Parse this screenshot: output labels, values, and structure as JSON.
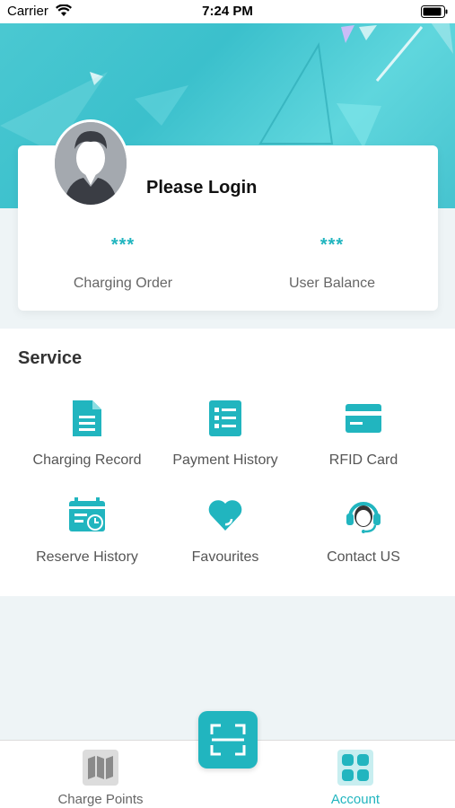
{
  "status_bar": {
    "carrier": "Carrier",
    "time": "7:24 PM"
  },
  "profile": {
    "login_text": "Please Login",
    "stats": [
      {
        "value": "***",
        "label": "Charging Order"
      },
      {
        "value": "***",
        "label": "User Balance"
      }
    ]
  },
  "service": {
    "title": "Service",
    "items": [
      {
        "label": "Charging Record",
        "icon": "document-icon"
      },
      {
        "label": "Payment History",
        "icon": "list-icon"
      },
      {
        "label": "RFID Card",
        "icon": "card-icon"
      },
      {
        "label": "Reserve History",
        "icon": "calendar-clock-icon"
      },
      {
        "label": "Favourites",
        "icon": "heart-icon"
      },
      {
        "label": "Contact US",
        "icon": "headset-icon"
      }
    ]
  },
  "tab_bar": {
    "tabs": [
      {
        "label": "Charge Points",
        "icon": "map-icon",
        "active": false
      },
      {
        "label": "Account",
        "icon": "grid-icon",
        "active": true
      }
    ],
    "scan_icon": "scan-icon"
  },
  "colors": {
    "accent": "#21b5bf",
    "inactive": "#666666",
    "background": "#eef4f6"
  }
}
